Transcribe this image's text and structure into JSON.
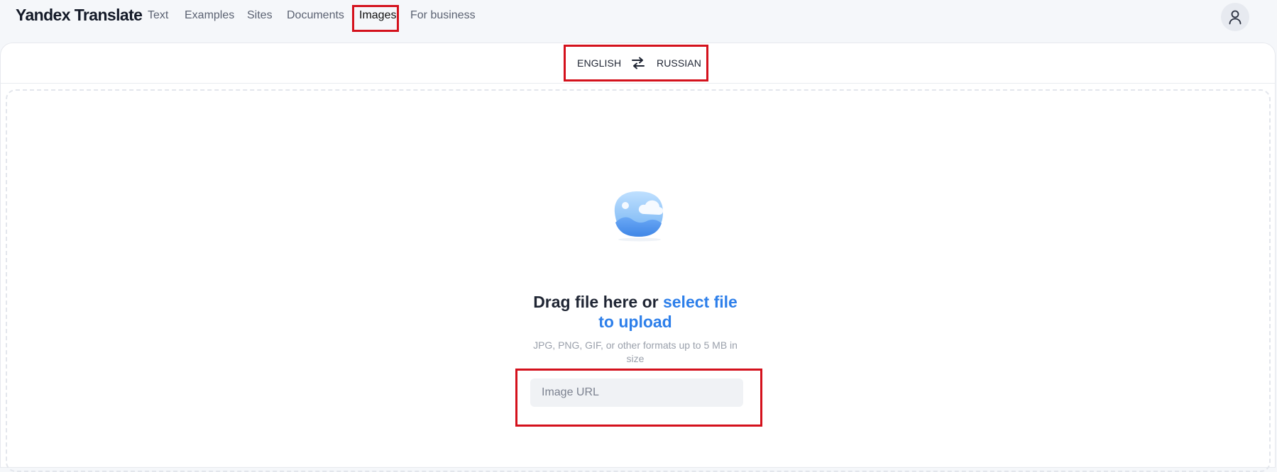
{
  "app": {
    "logo": "Yandex Translate"
  },
  "nav": {
    "items": [
      {
        "label": "Text"
      },
      {
        "label": "Examples"
      },
      {
        "label": "Sites"
      },
      {
        "label": "Documents"
      },
      {
        "label": "Images",
        "active": true
      },
      {
        "label": "For business"
      }
    ]
  },
  "header": {
    "avatar_icon": "user-icon"
  },
  "languages": {
    "source": "ENGLISH",
    "target": "RUSSIAN",
    "swap_icon": "swap-arrows-icon"
  },
  "upload": {
    "illustration_icon": "image-cloud-icon",
    "headline_prefix": "Drag file here or",
    "headline_link": "select file to upload",
    "hint": "JPG, PNG, GIF, or other formats up to 5 MB in size",
    "url_placeholder": "Image URL",
    "url_value": ""
  },
  "colors": {
    "accent_link": "#2d7fea",
    "highlight": "#d4111c",
    "page_bg": "#f5f7fa"
  }
}
